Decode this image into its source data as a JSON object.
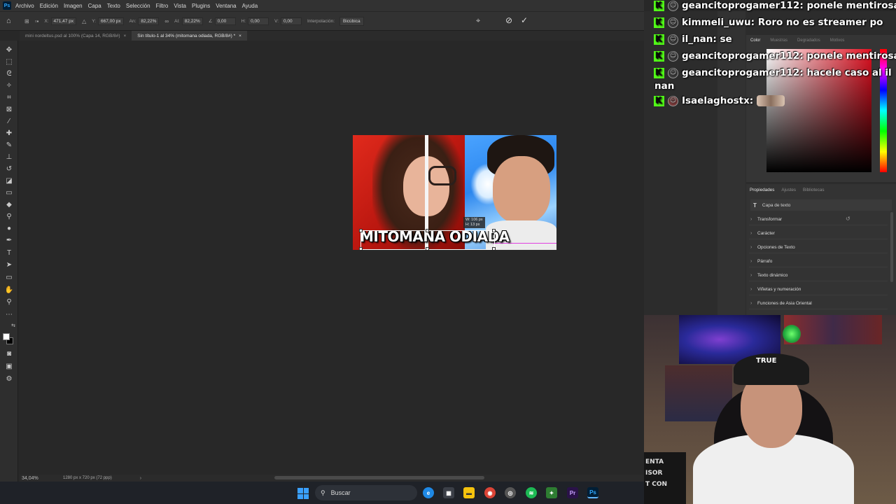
{
  "app": {
    "logo_text": "Ps",
    "menu": [
      "Archivo",
      "Edición",
      "Imagen",
      "Capa",
      "Texto",
      "Selección",
      "Filtro",
      "Vista",
      "Plugins",
      "Ventana",
      "Ayuda"
    ]
  },
  "options": {
    "x_label": "X:",
    "x_value": "471,47 px",
    "y_label": "Y:",
    "y_value": "667,00 px",
    "w_label": "An:",
    "w_value": "82,22%",
    "h_label": "Al:",
    "h_value": "82,22%",
    "angle_value": "0,00",
    "hskew_label": "H:",
    "hskew_value": "0,00",
    "vskew_label": "V:",
    "vskew_value": "0,00",
    "interp_label": "Interpolación:",
    "interp_value": "Bicúbica"
  },
  "tabs": [
    {
      "label": "mini nordeltus.psd al 100% (Capa 14, RGB/8#)",
      "close": "×"
    },
    {
      "label": "Sin título-1 al 34% (mitomana odiada, RGB/8#) *",
      "close": "×"
    }
  ],
  "document": {
    "title_text": "MITOMANA ODIADA",
    "dims_w": "W: 106 px",
    "dims_h": "H: 13 px"
  },
  "status": {
    "zoom": "34,04%",
    "doc_info": "1280 px x 720 px (72 ppp)",
    "arrow": "›"
  },
  "color_panel": {
    "tabs": [
      "Color",
      "Muestras",
      "Degradados",
      "Motivos"
    ]
  },
  "properties": {
    "tabs": [
      "Propiedades",
      "Ajustes",
      "Bibliotecas"
    ],
    "layer_type": "Capa de texto",
    "sections": [
      "Transformar",
      "Carácter",
      "Opciones de Texto",
      "Párrafo",
      "Texto dinámico",
      "Viñetas y numeración",
      "Funciones de Asia Oriental"
    ]
  },
  "chat": [
    {
      "user": "geancitoprogamer112:",
      "msg": "ponele mentirosa"
    },
    {
      "user": "kimmeli_uwu:",
      "msg": "Roro no es streamer po"
    },
    {
      "user": "il_nan:",
      "msg": "se"
    },
    {
      "user": "geancitoprogamer112:",
      "msg": "ponele mentirosa"
    },
    {
      "user": "geancitoprogamer112:",
      "msg": "hacele caso al il"
    },
    {
      "user": "",
      "msg": "nan"
    },
    {
      "user": "Isaelaghostx:",
      "msg": ""
    }
  ],
  "webcam": {
    "cap_logo": "TRUE",
    "sign_lines": [
      "ENTA",
      "ISOR",
      "T CON"
    ]
  },
  "taskbar": {
    "search_placeholder": "Buscar"
  },
  "colors": {
    "kick_green": "#53fc18",
    "ps_blue": "#31a8ff",
    "panel_bg": "#333333"
  }
}
